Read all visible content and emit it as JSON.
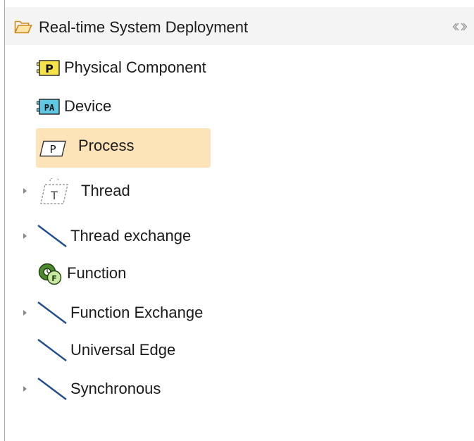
{
  "drawer": {
    "title": "Real-time System Deployment",
    "icon": "open-folder-icon",
    "pin_icon": "collapse-arrows-icon"
  },
  "items": [
    {
      "label": "Physical Component",
      "icon": "physical-component-icon",
      "expandable": false,
      "selected": false
    },
    {
      "label": "Device",
      "icon": "device-icon",
      "expandable": false,
      "selected": false
    },
    {
      "label": "Process",
      "icon": "process-icon",
      "expandable": false,
      "selected": true
    },
    {
      "label": "Thread",
      "icon": "thread-icon",
      "expandable": true,
      "selected": false
    },
    {
      "label": "Thread exchange",
      "icon": "edge-line-icon",
      "expandable": true,
      "selected": false
    },
    {
      "label": "Function",
      "icon": "function-icon",
      "expandable": false,
      "selected": false
    },
    {
      "label": "Function Exchange",
      "icon": "edge-line-icon",
      "expandable": true,
      "selected": false
    },
    {
      "label": "Universal Edge",
      "icon": "edge-line-icon",
      "expandable": false,
      "selected": false
    },
    {
      "label": "Synchronous",
      "icon": "edge-line-icon",
      "expandable": true,
      "selected": false
    }
  ],
  "colors": {
    "selection": "#fce3b8",
    "component_yellow": "#f6e24a",
    "device_teal": "#5fc8e3",
    "function_green": "#4c8a2c",
    "edge_blue": "#1f4e91"
  }
}
